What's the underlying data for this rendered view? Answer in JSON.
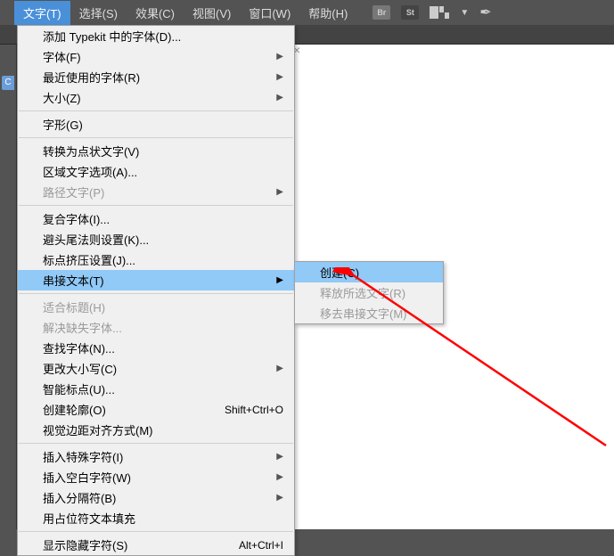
{
  "menubar": {
    "items": [
      "文字(T)",
      "选择(S)",
      "效果(C)",
      "视图(V)",
      "窗口(W)",
      "帮助(H)"
    ],
    "active_index": 0,
    "icon_br": "Br",
    "icon_st": "St"
  },
  "left_tab": "C",
  "tab_close": "×",
  "dropdown": {
    "groups": [
      [
        {
          "label": "添加 Typekit 中的字体(D)...",
          "enabled": true
        },
        {
          "label": "字体(F)",
          "enabled": true,
          "submenu": true
        },
        {
          "label": "最近使用的字体(R)",
          "enabled": true,
          "submenu": true
        },
        {
          "label": "大小(Z)",
          "enabled": true,
          "submenu": true
        }
      ],
      [
        {
          "label": "字形(G)",
          "enabled": true
        }
      ],
      [
        {
          "label": "转换为点状文字(V)",
          "enabled": true
        },
        {
          "label": "区域文字选项(A)...",
          "enabled": true
        },
        {
          "label": "路径文字(P)",
          "enabled": false,
          "submenu": true
        }
      ],
      [
        {
          "label": "复合字体(I)...",
          "enabled": true
        },
        {
          "label": "避头尾法则设置(K)...",
          "enabled": true
        },
        {
          "label": "标点挤压设置(J)...",
          "enabled": true
        },
        {
          "label": "串接文本(T)",
          "enabled": true,
          "submenu": true,
          "highlighted": true
        }
      ],
      [
        {
          "label": "适合标题(H)",
          "enabled": false
        },
        {
          "label": "解决缺失字体...",
          "enabled": false
        },
        {
          "label": "查找字体(N)...",
          "enabled": true
        },
        {
          "label": "更改大小写(C)",
          "enabled": true,
          "submenu": true
        },
        {
          "label": "智能标点(U)...",
          "enabled": true
        },
        {
          "label": "创建轮廓(O)",
          "enabled": true,
          "shortcut": "Shift+Ctrl+O"
        },
        {
          "label": "视觉边距对齐方式(M)",
          "enabled": true
        }
      ],
      [
        {
          "label": "插入特殊字符(I)",
          "enabled": true,
          "submenu": true
        },
        {
          "label": "插入空白字符(W)",
          "enabled": true,
          "submenu": true
        },
        {
          "label": "插入分隔符(B)",
          "enabled": true,
          "submenu": true
        },
        {
          "label": "用占位符文本填充",
          "enabled": true
        }
      ],
      [
        {
          "label": "显示隐藏字符(S)",
          "enabled": true,
          "shortcut": "Alt+Ctrl+I"
        }
      ]
    ]
  },
  "submenu": {
    "items": [
      {
        "label": "创建(C)",
        "enabled": true,
        "highlighted": true
      },
      {
        "label": "释放所选文字(R)",
        "enabled": false
      },
      {
        "label": "移去串接文字(M)",
        "enabled": false
      }
    ]
  }
}
